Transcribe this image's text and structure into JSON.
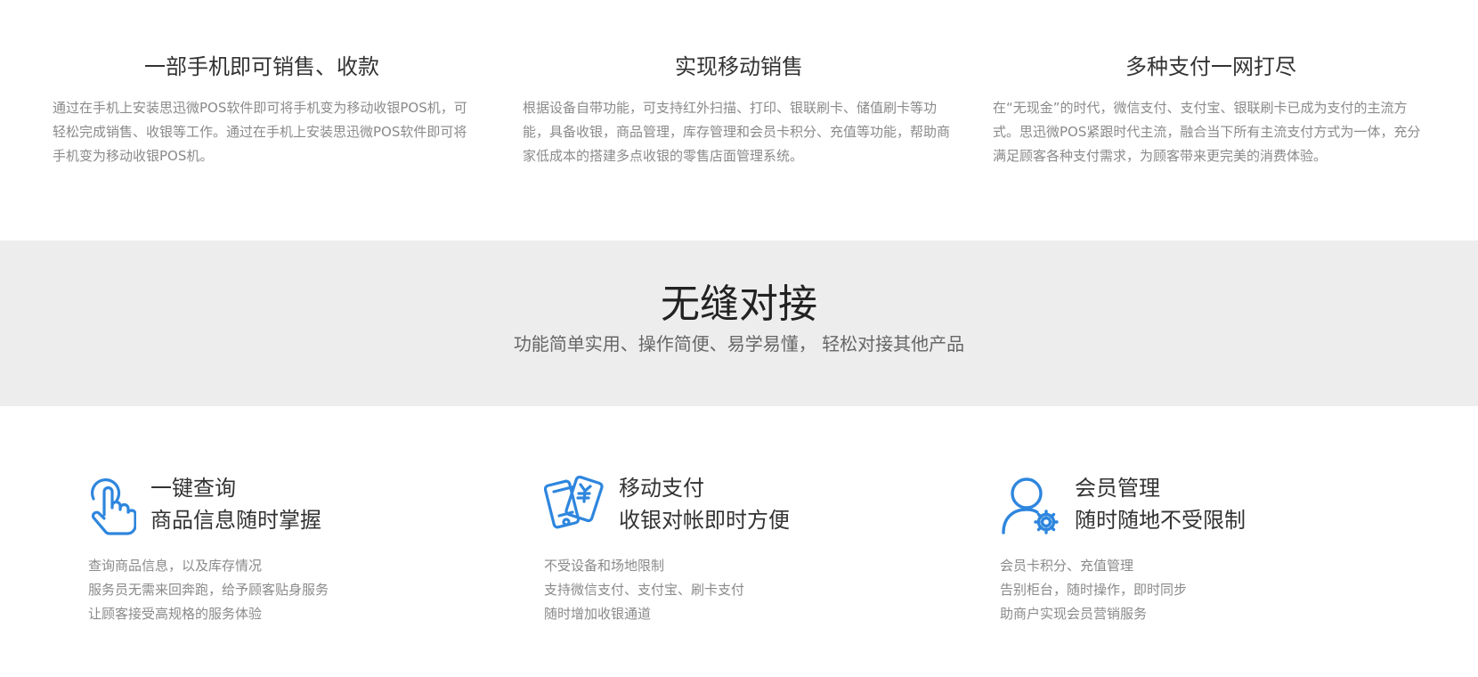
{
  "top_features": [
    {
      "title": "一部手机即可销售、收款",
      "description": "通过在手机上安装思迅微POS软件即可将手机变为移动收银POS机，可轻松完成销售、收银等工作。通过在手机上安装思迅微POS软件即可将手机变为移动收银POS机。"
    },
    {
      "title": "实现移动销售",
      "description": "根据设备自带功能，可支持红外扫描、打印、银联刷卡、储值刷卡等功能，具备收银，商品管理，库存管理和会员卡积分、充值等功能，帮助商家低成本的搭建多点收银的零售店面管理系统。"
    },
    {
      "title": "多种支付一网打尽",
      "description": "在“无现金”的时代，微信支付、支付宝、银联刷卡已成为支付的主流方式。思迅微POS紧跟时代主流，融合当下所有主流支付方式为一体，充分满足顾客各种支付需求，为顾客带来更完美的消费体验。"
    }
  ],
  "banner": {
    "title": "无缝对接",
    "subtitle": "功能简单实用、操作简便、易学易懂， 轻松对接其他产品",
    "background_color": "#ededed"
  },
  "features": [
    {
      "icon": "touch-hand-icon",
      "title": "一键查询",
      "subtitle": "商品信息随时掌握",
      "items": [
        "查询商品信息，以及库存情况",
        "服务员无需来回奔跑，给予顾客贴身服务",
        "让顾客接受高规格的服务体验"
      ]
    },
    {
      "icon": "mobile-payment-icon",
      "title": "移动支付",
      "subtitle": "收银对帐即时方便",
      "items": [
        "不受设备和场地限制",
        "支持微信支付、支付宝、刷卡支付",
        "随时增加收银通道"
      ]
    },
    {
      "icon": "member-settings-icon",
      "title": "会员管理",
      "subtitle": "随时随地不受限制",
      "items": [
        "会员卡积分、充值管理",
        "告别柜台，随时操作，即时同步",
        "助商户实现会员营销服务"
      ]
    }
  ],
  "colors": {
    "icon_blue": "#2e86de",
    "text_dark": "#333333",
    "text_muted": "#8a8a8a"
  }
}
